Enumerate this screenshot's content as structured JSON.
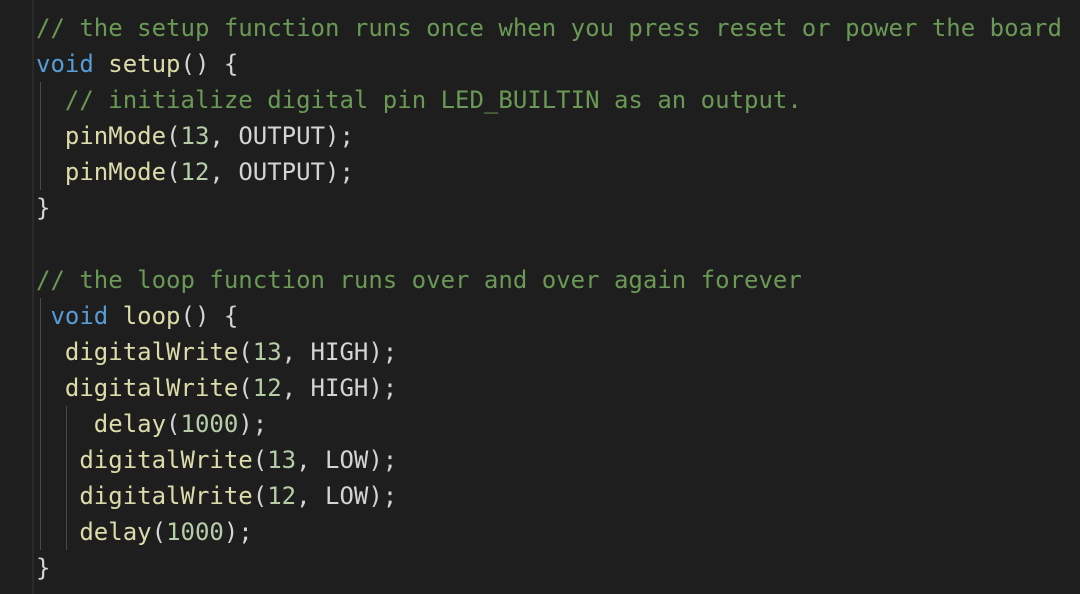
{
  "code": {
    "lines": [
      {
        "indent": "",
        "tokens": [
          {
            "t": "// the setup function runs once when you press reset or power the board",
            "k": "comment"
          }
        ]
      },
      {
        "indent": "",
        "tokens": [
          {
            "t": "void",
            "k": "keyword"
          },
          {
            "t": " ",
            "k": "plain"
          },
          {
            "t": "setup",
            "k": "func"
          },
          {
            "t": "() {",
            "k": "plain"
          }
        ]
      },
      {
        "indent": "  ",
        "tokens": [
          {
            "t": "// initialize digital pin LED_BUILTIN as an output.",
            "k": "comment"
          }
        ]
      },
      {
        "indent": "  ",
        "tokens": [
          {
            "t": "pinMode",
            "k": "func"
          },
          {
            "t": "(",
            "k": "plain"
          },
          {
            "t": "13",
            "k": "num"
          },
          {
            "t": ", OUTPUT);",
            "k": "plain"
          }
        ]
      },
      {
        "indent": "  ",
        "tokens": [
          {
            "t": "pinMode",
            "k": "func"
          },
          {
            "t": "(",
            "k": "plain"
          },
          {
            "t": "12",
            "k": "num"
          },
          {
            "t": ", OUTPUT);",
            "k": "plain"
          }
        ]
      },
      {
        "indent": "",
        "tokens": [
          {
            "t": "}",
            "k": "plain"
          }
        ]
      },
      {
        "indent": "",
        "tokens": []
      },
      {
        "indent": "",
        "tokens": [
          {
            "t": "// the loop function runs over and over again forever",
            "k": "comment"
          }
        ]
      },
      {
        "indent": " ",
        "tokens": [
          {
            "t": "void",
            "k": "keyword"
          },
          {
            "t": " ",
            "k": "plain"
          },
          {
            "t": "loop",
            "k": "func"
          },
          {
            "t": "() {",
            "k": "plain"
          }
        ]
      },
      {
        "indent": "  ",
        "tokens": [
          {
            "t": "digitalWrite",
            "k": "func"
          },
          {
            "t": "(",
            "k": "plain"
          },
          {
            "t": "13",
            "k": "num"
          },
          {
            "t": ", HIGH);",
            "k": "plain"
          }
        ]
      },
      {
        "indent": "  ",
        "tokens": [
          {
            "t": "digitalWrite",
            "k": "func"
          },
          {
            "t": "(",
            "k": "plain"
          },
          {
            "t": "12",
            "k": "num"
          },
          {
            "t": ", HIGH);",
            "k": "plain"
          }
        ]
      },
      {
        "indent": "    ",
        "tokens": [
          {
            "t": "delay",
            "k": "func"
          },
          {
            "t": "(",
            "k": "plain"
          },
          {
            "t": "1000",
            "k": "num"
          },
          {
            "t": ");",
            "k": "plain"
          }
        ]
      },
      {
        "indent": "   ",
        "tokens": [
          {
            "t": "digitalWrite",
            "k": "func"
          },
          {
            "t": "(",
            "k": "plain"
          },
          {
            "t": "13",
            "k": "num"
          },
          {
            "t": ", LOW);",
            "k": "plain"
          }
        ]
      },
      {
        "indent": "   ",
        "tokens": [
          {
            "t": "digitalWrite",
            "k": "func"
          },
          {
            "t": "(",
            "k": "plain"
          },
          {
            "t": "12",
            "k": "num"
          },
          {
            "t": ", LOW);",
            "k": "plain"
          }
        ]
      },
      {
        "indent": "   ",
        "tokens": [
          {
            "t": "delay",
            "k": "func"
          },
          {
            "t": "(",
            "k": "plain"
          },
          {
            "t": "1000",
            "k": "num"
          },
          {
            "t": ");",
            "k": "plain"
          }
        ]
      },
      {
        "indent": "",
        "tokens": [
          {
            "t": "}",
            "k": "plain"
          }
        ]
      }
    ]
  },
  "theme": {
    "background": "#1e1e1e",
    "comment": "#6a9955",
    "keyword": "#569cd6",
    "function": "#dcdcaa",
    "number": "#b5cea8",
    "text": "#d4d4d4"
  }
}
